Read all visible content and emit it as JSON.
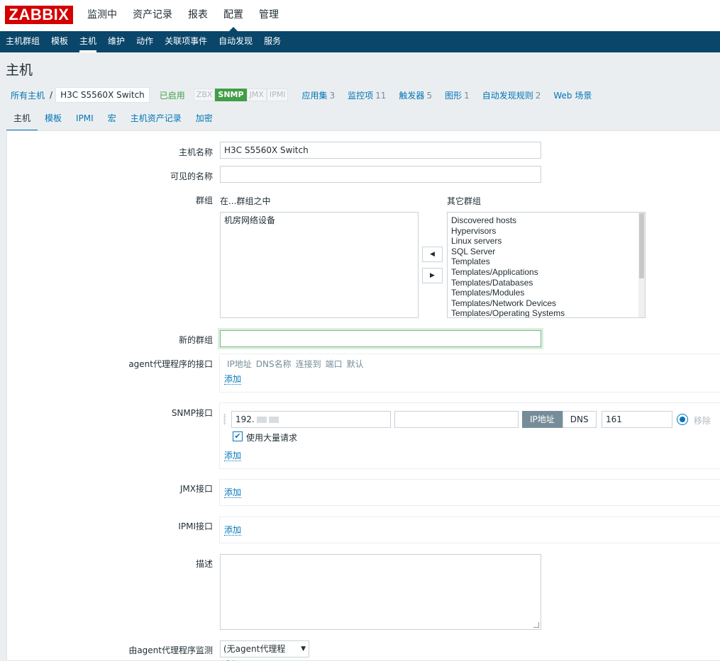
{
  "brand": {
    "logo": "ZABBIX",
    "color": "#d40000",
    "nav_color": "#0a466a"
  },
  "top_menu": [
    "监测中",
    "资产记录",
    "报表",
    "配置",
    "管理"
  ],
  "top_menu_active": "配置",
  "sub_menu": [
    "主机群组",
    "模板",
    "主机",
    "维护",
    "动作",
    "关联项事件",
    "自动发现",
    "服务"
  ],
  "sub_menu_active": "主机",
  "page_title": "主机",
  "breadcrumb": {
    "all_hosts": "所有主机",
    "separator": "/",
    "current_host": "H3C S5560X Switch",
    "status": "已启用"
  },
  "availability": [
    {
      "label": "ZBX",
      "active": false
    },
    {
      "label": "SNMP",
      "active": true
    },
    {
      "label": "JMX",
      "active": false
    },
    {
      "label": "IPMI",
      "active": false
    }
  ],
  "counts": [
    {
      "label": "应用集",
      "n": "3"
    },
    {
      "label": "监控项",
      "n": "11"
    },
    {
      "label": "触发器",
      "n": "5"
    },
    {
      "label": "图形",
      "n": "1"
    },
    {
      "label": "自动发现规则",
      "n": "2"
    },
    {
      "label": "Web 场景",
      "n": ""
    }
  ],
  "tabs": [
    "主机",
    "模板",
    "IPMI",
    "宏",
    "主机资产记录",
    "加密"
  ],
  "form": {
    "host_name_label": "主机名称",
    "host_name_value": "H3C S5560X Switch",
    "visible_name_label": "可见的名称",
    "visible_name_value": "",
    "groups_label": "群组",
    "in_groups_label": "在...群组之中",
    "other_groups_label": "其它群组",
    "in_groups": [
      "机房网络设备"
    ],
    "other_groups": [
      "Discovered hosts",
      "Hypervisors",
      "Linux servers",
      "SQL Server",
      "Templates",
      "Templates/Applications",
      "Templates/Databases",
      "Templates/Modules",
      "Templates/Network Devices",
      "Templates/Operating Systems"
    ],
    "move_left": "◀",
    "move_right": "▶",
    "new_group_label": "新的群组",
    "new_group_value": "",
    "agent_if_label": "agent代理程序的接口",
    "if_headers": [
      "IP地址",
      "DNS名称",
      "连接到",
      "端口",
      "默认"
    ],
    "add_label": "添加",
    "snmp_if_label": "SNMP接口",
    "snmp_ip": "192.",
    "snmp_dns": "",
    "connect_ip": "IP地址",
    "connect_dns": "DNS",
    "snmp_port": "161",
    "remove_label": "移除",
    "bulk_label": "使用大量请求",
    "jmx_if_label": "JMX接口",
    "ipmi_if_label": "IPMI接口",
    "description_label": "描述",
    "description_value": "",
    "proxy_label": "由agent代理程序监测",
    "proxy_value": "(无agent代理程序)"
  }
}
